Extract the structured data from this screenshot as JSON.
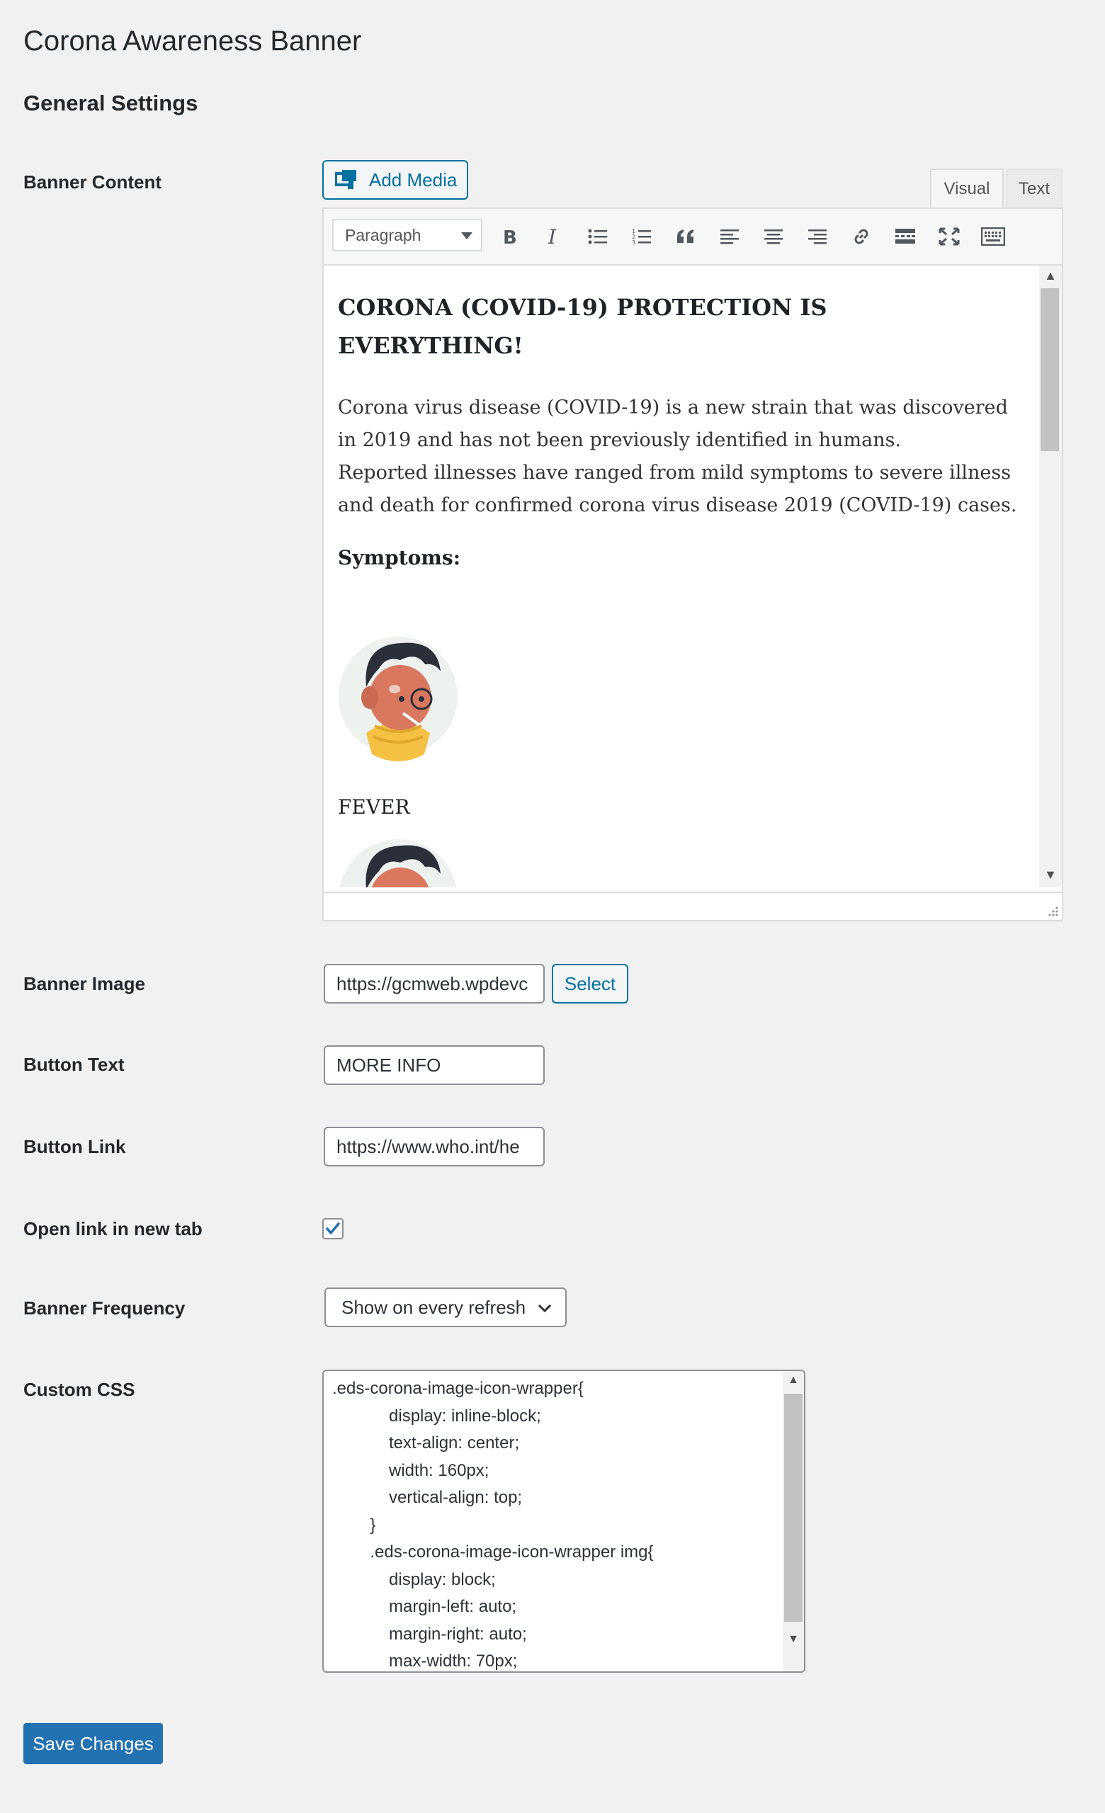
{
  "page_title": "Corona Awareness Banner",
  "section_title": "General Settings",
  "labels": {
    "banner_content": "Banner Content",
    "banner_image": "Banner Image",
    "button_text": "Button Text",
    "button_link": "Button Link",
    "open_new_tab": "Open link in new tab",
    "banner_frequency": "Banner Frequency",
    "custom_css": "Custom CSS"
  },
  "editor": {
    "add_media_label": "Add Media",
    "tabs": {
      "visual": "Visual",
      "text": "Text"
    },
    "format_select": "Paragraph",
    "toolbar_icons": [
      "bold-icon",
      "italic-icon",
      "bulleted-list-icon",
      "numbered-list-icon",
      "blockquote-icon",
      "align-left-icon",
      "align-center-icon",
      "align-right-icon",
      "link-icon",
      "read-more-icon",
      "fullscreen-icon",
      "toolbar-toggle-icon"
    ],
    "heading": "CORONA (COVID-19) PROTECTION IS EVERYTHING!",
    "body": "Corona virus disease (COVID-19) is a new strain that was discovered in 2019 and has not been previously identified in humans.\nReported illnesses have ranged from mild symptoms to severe illness and death for confirmed corona virus disease 2019 (COVID-19) cases.",
    "symptoms_heading": "Symptoms:",
    "fever_label": "FEVER"
  },
  "fields": {
    "banner_image_value": "https://gcmweb.wpdevc",
    "select_button": "Select",
    "button_text_value": "MORE INFO",
    "button_link_value": "https://www.who.int/he",
    "open_new_tab_checked": true,
    "frequency_value": "Show on every refresh",
    "custom_css_value": ".eds-corona-image-icon-wrapper{\n            display: inline-block;\n            text-align: center;\n            width: 160px;\n            vertical-align: top;\n        }\n        .eds-corona-image-icon-wrapper img{\n            display: block;\n            margin-left: auto;\n            margin-right: auto;\n            max-width: 70px;"
  },
  "save_button": "Save Changes",
  "colors": {
    "page_bg": "#f1f1f1",
    "primary": "#2271b1",
    "link_blue": "#0071a1"
  }
}
